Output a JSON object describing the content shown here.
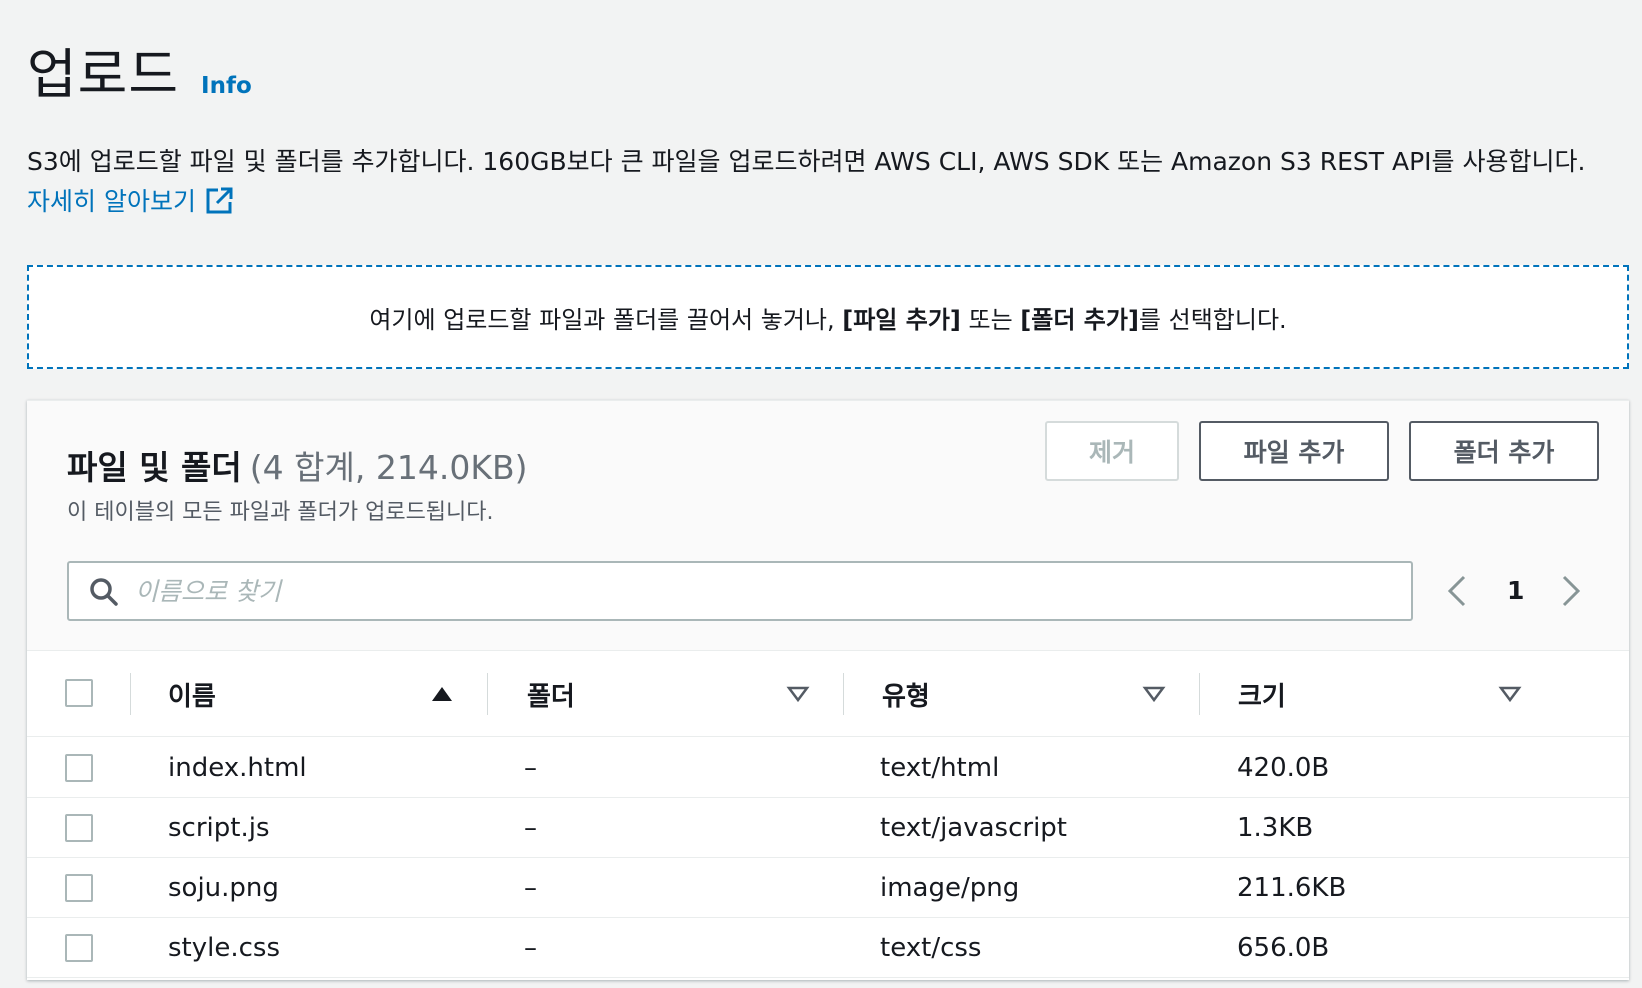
{
  "header": {
    "title": "업로드",
    "info_label": "Info"
  },
  "description": {
    "text": "S3에 업로드할 파일 및 폴더를 추가합니다. 160GB보다 큰 파일을 업로드하려면 AWS CLI, AWS SDK 또는 Amazon S3 REST API를 사용합니다.",
    "learn_more": "자세히 알아보기",
    "icon": "external-link-icon"
  },
  "dropzone": {
    "prefix": "여기에 업로드할 파일과 폴더를 끌어서 놓거나, ",
    "add_files": "[파일 추가]",
    "middle": " 또는 ",
    "add_folder": "[폴더 추가]",
    "suffix": "를 선택합니다."
  },
  "panel": {
    "title": "파일 및 폴더",
    "count": "(4 합계, 214.0KB)",
    "description": "이 테이블의 모든 파일과 폴더가 업로드됩니다.",
    "buttons": {
      "remove": "제거",
      "add_files": "파일 추가",
      "add_folder": "폴더 추가"
    },
    "search": {
      "placeholder": "이름으로 찾기",
      "icon": "search-icon"
    },
    "pagination": {
      "current_page": "1"
    }
  },
  "table": {
    "columns": [
      {
        "label": "이름",
        "sort": "ascending"
      },
      {
        "label": "폴더",
        "sort": "none"
      },
      {
        "label": "유형",
        "sort": "none"
      },
      {
        "label": "크기",
        "sort": "none"
      }
    ],
    "rows": [
      {
        "name": "index.html",
        "folder": "–",
        "type": "text/html",
        "size": "420.0B"
      },
      {
        "name": "script.js",
        "folder": "–",
        "type": "text/javascript",
        "size": "1.3KB"
      },
      {
        "name": "soju.png",
        "folder": "–",
        "type": "image/png",
        "size": "211.6KB"
      },
      {
        "name": "style.css",
        "folder": "–",
        "type": "text/css",
        "size": "656.0B"
      }
    ]
  },
  "colors": {
    "link": "#0073bb",
    "background": "#f2f3f3",
    "border": "#aab7b8"
  }
}
